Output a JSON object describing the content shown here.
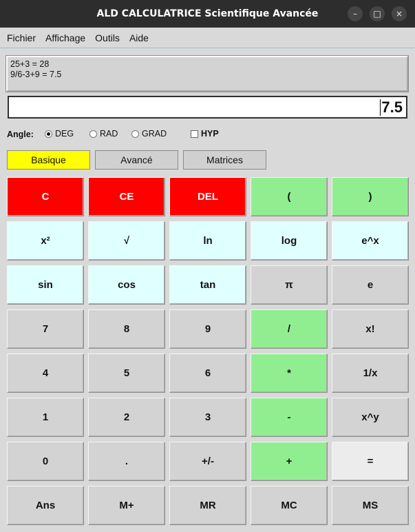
{
  "window": {
    "title": "ALD CALCULATRICE Scientifique Avancée",
    "controls": [
      "–",
      "□",
      "×"
    ]
  },
  "menu": [
    "Fichier",
    "Affichage",
    "Outils",
    "Aide"
  ],
  "history": [
    "25+3 = 28",
    "9/6-3+9 = 7.5"
  ],
  "display": {
    "value": "7.5"
  },
  "angle": {
    "label": "Angle:",
    "options": [
      "DEG",
      "RAD",
      "GRAD"
    ],
    "selected": "DEG",
    "hyp_label": "HYP",
    "hyp_checked": false
  },
  "tabs": [
    "Basique",
    "Avancé",
    "Matrices"
  ],
  "active_tab": "Basique",
  "colors": {
    "red": "#ff0000",
    "green": "#90ee90",
    "cyan": "#e0ffff",
    "gray": "#d3d3d3",
    "active_tab": "#ffff00"
  },
  "keys": [
    [
      "C",
      "CE",
      "DEL",
      "(",
      ")"
    ],
    [
      "x²",
      "√",
      "ln",
      "log",
      "e^x"
    ],
    [
      "sin",
      "cos",
      "tan",
      "π",
      "e"
    ],
    [
      "7",
      "8",
      "9",
      "/",
      "x!"
    ],
    [
      "4",
      "5",
      "6",
      "*",
      "1/x"
    ],
    [
      "1",
      "2",
      "3",
      "-",
      "x^y"
    ],
    [
      "0",
      ".",
      "+/-",
      "+",
      "="
    ],
    [
      "Ans",
      "M+",
      "MR",
      "MC",
      "MS"
    ]
  ]
}
